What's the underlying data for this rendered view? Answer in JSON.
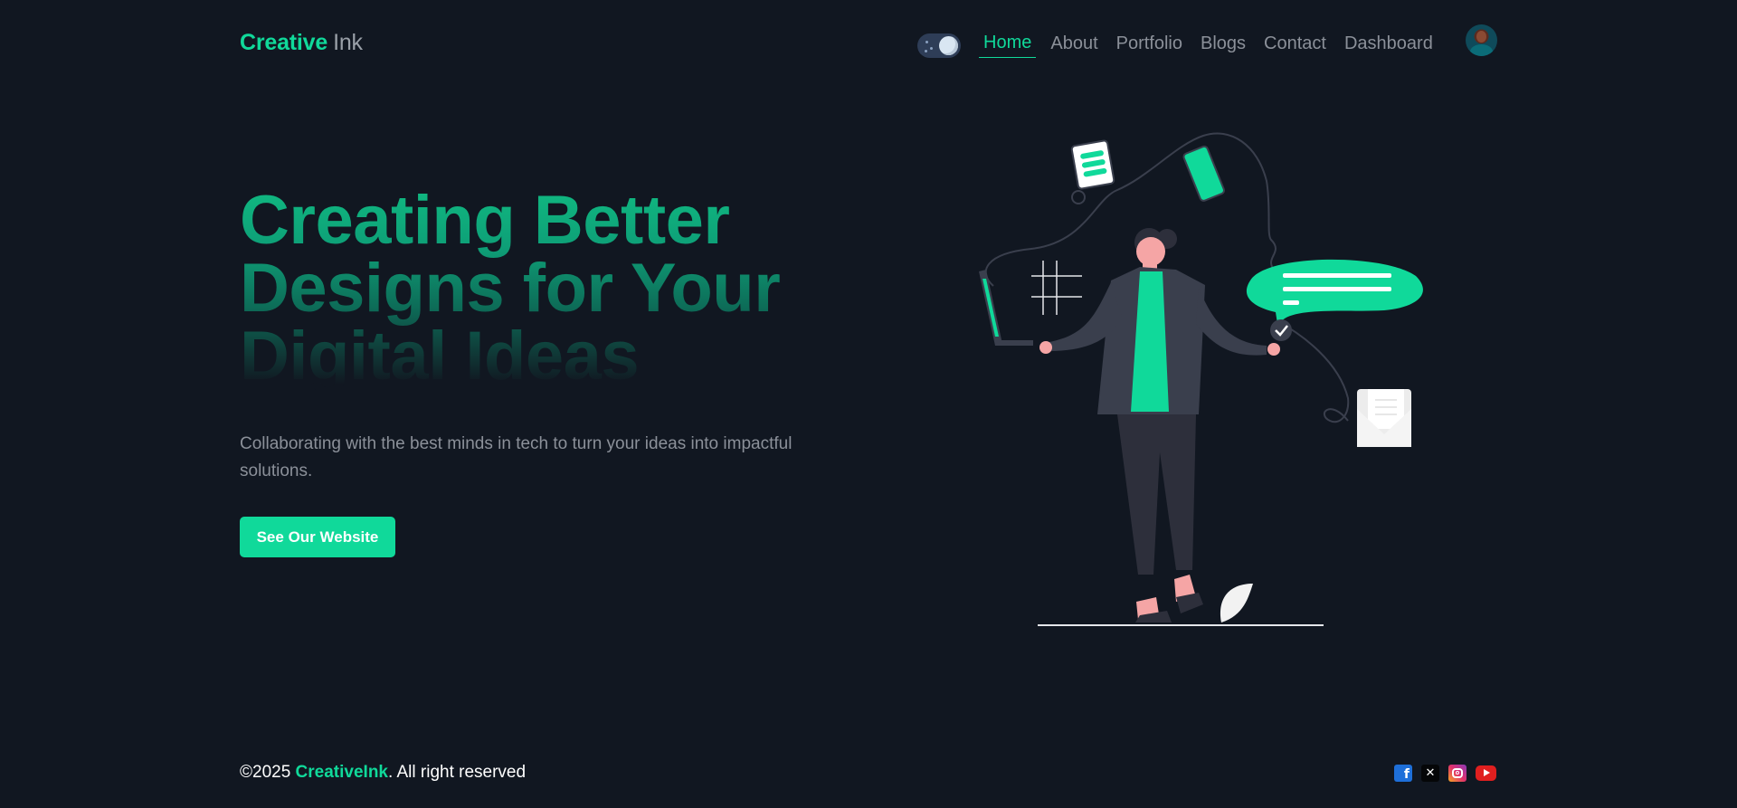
{
  "header": {
    "logo_primary": "Creative",
    "logo_secondary": "Ink",
    "theme_toggle_state": "dark",
    "nav": [
      {
        "label": "Home",
        "active": true
      },
      {
        "label": "About",
        "active": false
      },
      {
        "label": "Portfolio",
        "active": false
      },
      {
        "label": "Blogs",
        "active": false
      },
      {
        "label": "Contact",
        "active": false
      },
      {
        "label": "Dashboard",
        "active": false
      }
    ]
  },
  "hero": {
    "title": "Creating Better Designs for Your Digital Ideas",
    "subtitle": "Collaborating with the best minds in tech to turn your ideas into impactful solutions.",
    "cta_label": "See Our Website"
  },
  "footer": {
    "copyright_prefix": "©2025 ",
    "brand": "CreativeInk",
    "copyright_suffix": ". All right reserved",
    "socials": [
      "facebook-icon",
      "x-icon",
      "instagram-icon",
      "youtube-icon"
    ]
  },
  "colors": {
    "background": "#111721",
    "accent": "#10d99a",
    "muted_text": "#8b9099"
  }
}
